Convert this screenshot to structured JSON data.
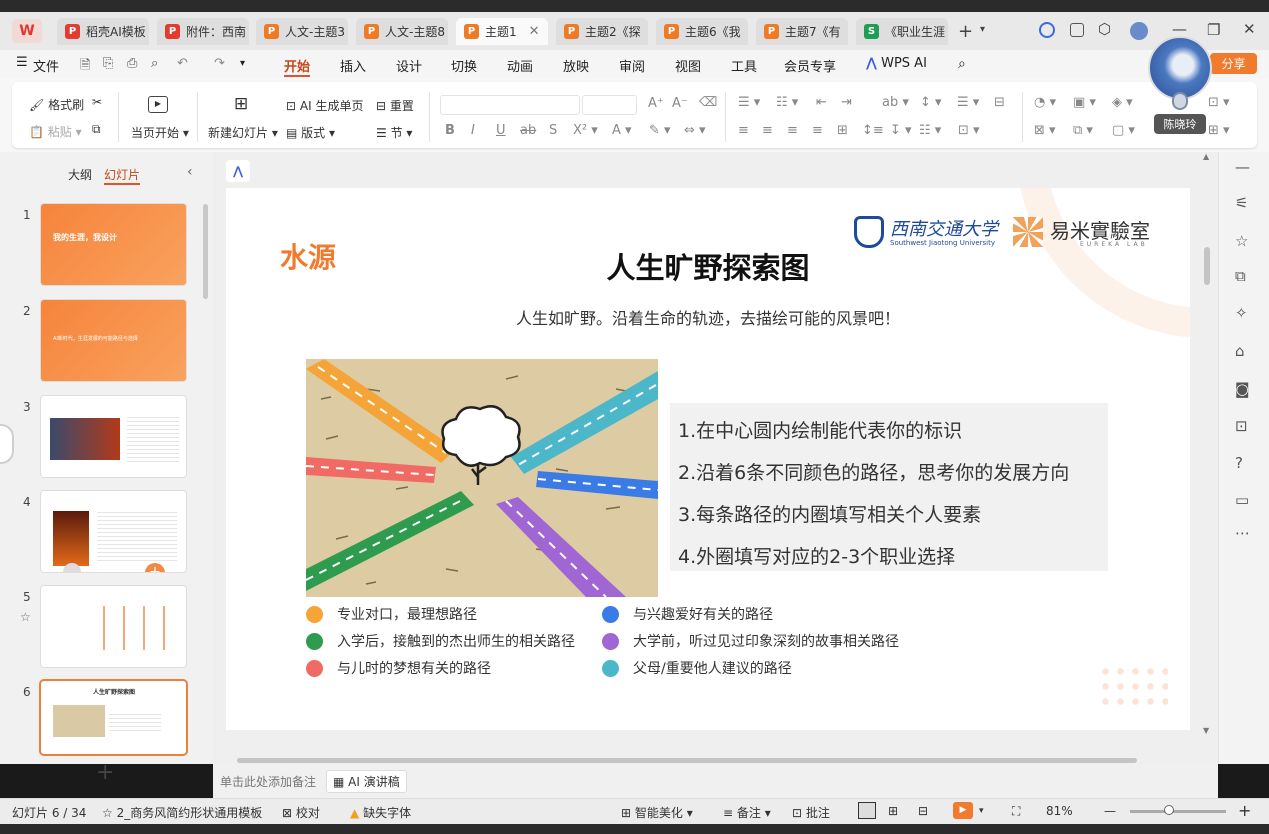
{
  "tabs": [
    {
      "label": "稻壳AI模板",
      "icon": "P",
      "color": "#e33b2f"
    },
    {
      "label": "附件：西南",
      "icon": "P",
      "color": "#e33b2f"
    },
    {
      "label": "人文-主题3",
      "icon": "P",
      "color": "#ef7a26"
    },
    {
      "label": "人文-主题8",
      "icon": "P",
      "color": "#ef7a26"
    },
    {
      "label": "主题1",
      "icon": "P",
      "color": "#ef7a26"
    },
    {
      "label": "主题2《探",
      "icon": "P",
      "color": "#ef7a26"
    },
    {
      "label": "主题6《我",
      "icon": "P",
      "color": "#ef7a26"
    },
    {
      "label": "主题7《有",
      "icon": "P",
      "color": "#ef7a26"
    },
    {
      "label": "《职业生涯",
      "icon": "S",
      "color": "#1f9d55"
    }
  ],
  "wps_logo": "W",
  "menu": {
    "file": "文件",
    "items": [
      "开始",
      "插入",
      "设计",
      "切换",
      "动画",
      "放映",
      "审阅",
      "视图",
      "工具",
      "会员专享"
    ],
    "wps_ai": "WPS AI",
    "share": "分享"
  },
  "ribbon": {
    "format_brush": "格式刷",
    "paste": "粘贴",
    "from_current": "当页开始",
    "new_slide": "新建幻灯片",
    "ai_gen": "AI 生成单页",
    "layout": "版式",
    "background": "重置",
    "section": "节"
  },
  "user": {
    "name": "陈晓玲"
  },
  "left_panel": {
    "outline": "大纲",
    "slides": "幻灯片",
    "slide_numbers": [
      "1",
      "2",
      "3",
      "4",
      "5",
      "6"
    ],
    "thumb1": "我的生涯，我设计",
    "thumb2": "AI新时代，生涯发展的可能路径与选择",
    "thumb6": "人生旷野探索图",
    "add": "+"
  },
  "slide": {
    "corner": "水源",
    "title": "人生旷野探索图",
    "subtitle": "人生如旷野。沿着生命的轨迹，去描绘可能的风景吧！",
    "logo_left_cn": "西南交通大学",
    "logo_left_en": "Southwest Jiaotong University",
    "logo_right_cn": "易米實驗室",
    "logo_right_en": "EUREKA LAB",
    "steps": [
      "1.在中心圆内绘制能代表你的标识",
      "2.沿着6条不同颜色的路径，思考你的发展方向",
      "3.每条路径的内圈填写相关个人要素",
      "4.外圈填写对应的2-3个职业选择"
    ],
    "legend": [
      {
        "text": "专业对口，最理想路径",
        "color": "#f5a537"
      },
      {
        "text": "与兴趣爱好有关的路径",
        "color": "#3b7be6"
      },
      {
        "text": "入学后，接触到的杰出师生的相关路径",
        "color": "#2e9b4f"
      },
      {
        "text": "大学前，听过见过印象深刻的故事相关路径",
        "color": "#a066d4"
      },
      {
        "text": "与儿时的梦想有关的路径",
        "color": "#f06b63"
      },
      {
        "text": "父母/重要他人建议的路径",
        "color": "#4cb7c9"
      }
    ]
  },
  "notes": {
    "placeholder": "单击此处添加备注",
    "ai_script": "AI 演讲稿"
  },
  "status": {
    "slide_info": "幻灯片 6 / 34",
    "template": "2_商务风简约形状通用模板",
    "proof": "校对",
    "missing_font": "缺失字体",
    "beautify": "智能美化",
    "notes": "备注",
    "comment": "批注",
    "zoom": "81%"
  }
}
